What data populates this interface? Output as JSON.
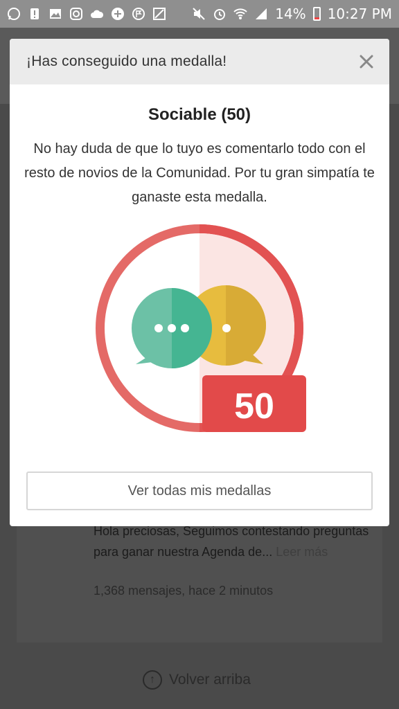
{
  "status_bar": {
    "battery": "14%",
    "time": "10:27 PM",
    "left_icons": [
      "whatsapp-icon",
      "alert-icon",
      "gallery-icon",
      "instagram-icon",
      "cloud-icon",
      "add-icon",
      "flag-icon",
      "map-icon"
    ],
    "right_icons": [
      "mute-icon",
      "alarm-icon",
      "wifi-icon",
      "signal-icon",
      "battery-icon"
    ]
  },
  "modal": {
    "title": "¡Has conseguido una medalla!",
    "medal_name": "Sociable (50)",
    "description": "No hay duda de que lo tuyo es comentarlo todo con el resto de novios de la Comunidad. Por tu gran simpatía te ganaste esta medalla.",
    "badge_number": "50",
    "button_label": "Ver todas mis medallas",
    "colors": {
      "ring": "#e46a67",
      "ring_dark": "#e05a5a",
      "green_bubble": "#4bb89a",
      "yellow_bubble": "#e7bc3e",
      "number_box": "#e24a4a"
    }
  },
  "background": {
    "post_text": "Hola preciosas, Seguimos contestando preguntas para ganar nuestra Agenda de...",
    "read_more": "Leer más",
    "post_meta": "1,368 mensajes, hace 2 minutos",
    "back_to_top": "Volver arriba"
  }
}
